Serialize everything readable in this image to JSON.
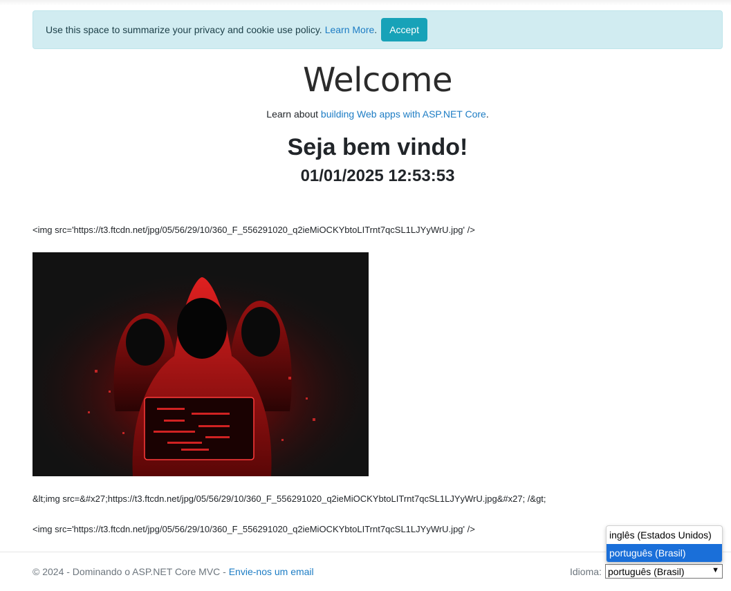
{
  "cookie_banner": {
    "text": "Use this space to summarize your privacy and cookie use policy.",
    "link_label": "Learn More",
    "punctuation": ".",
    "accept_label": "Accept"
  },
  "hero": {
    "title": "Welcome",
    "learn_prefix": "Learn about ",
    "learn_link": "building Web apps with ASP.NET Core",
    "learn_suffix": "."
  },
  "greeting": {
    "heading": "Seja bem vindo!",
    "datetime": "01/01/2025 12:53:53"
  },
  "content": {
    "raw_tag_1": "<img src='https://t3.ftcdn.net/jpg/05/56/29/10/360_F_556291020_q2ieMiOCKYbtoLITrnt7qcSL1LJYyWrU.jpg' />",
    "encoded_tag": "&lt;img src=&#x27;https://t3.ftcdn.net/jpg/05/56/29/10/360_F_556291020_q2ieMiOCKYbtoLITrnt7qcSL1LJYyWrU.jpg&#x27; /&gt;",
    "raw_tag_2": "<img src='https://t3.ftcdn.net/jpg/05/56/29/10/360_F_556291020_q2ieMiOCKYbtoLITrnt7qcSL1LJYyWrU.jpg' />"
  },
  "footer": {
    "copyright": "© 2024 - Dominando o ASP.NET Core MVC - ",
    "email_link": "Envie-nos um email",
    "language_label": "Idioma:",
    "selected_language": "português (Brasil)",
    "language_options": [
      "inglês (Estados Unidos)",
      "português (Brasil)"
    ]
  },
  "colors": {
    "banner_bg": "#d1ecf1",
    "accept_button": "#17a2b8",
    "link": "#1c7cc4",
    "dropdown_selected": "#1a6fd9"
  }
}
